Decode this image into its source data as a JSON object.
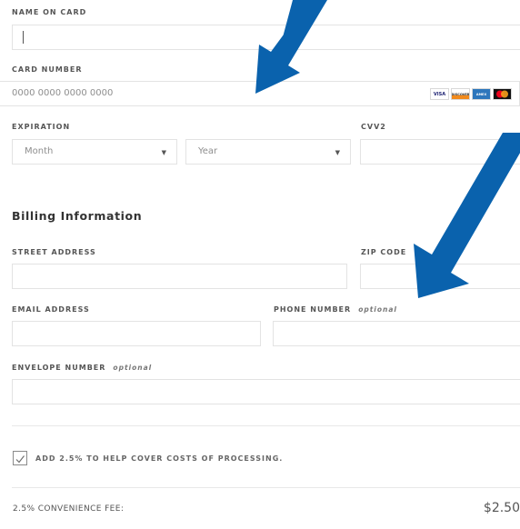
{
  "payment": {
    "name_label": "NAME ON CARD",
    "card_number_label": "CARD NUMBER",
    "card_number_placeholder": "0000 0000 0000 0000",
    "expiration_label": "EXPIRATION",
    "month_value": "Month",
    "year_value": "Year",
    "cvv_label": "CVV2",
    "card_brands": [
      "VISA",
      "DISCOVER",
      "AMEX",
      "mastercard"
    ],
    "card_brand_icons": [
      "visa-icon",
      "discover-icon",
      "amex-icon",
      "mastercard-icon"
    ]
  },
  "billing": {
    "title": "Billing Information",
    "street_label": "STREET ADDRESS",
    "zip_label": "ZIP CODE",
    "email_label": "EMAIL ADDRESS",
    "phone_label": "PHONE NUMBER",
    "phone_optional": "optional",
    "envelope_label": "ENVELOPE NUMBER",
    "envelope_optional": "optional"
  },
  "fee": {
    "checkbox_label": "ADD 2.5% TO HELP COVER COSTS OF PROCESSING.",
    "checkbox_checked": true,
    "fee_label": "2.5% CONVENIENCE FEE:",
    "fee_amount": "$2.50"
  },
  "colors": {
    "arrow": "#0a62ad",
    "border": "#e3e3e3",
    "label": "#555555"
  }
}
